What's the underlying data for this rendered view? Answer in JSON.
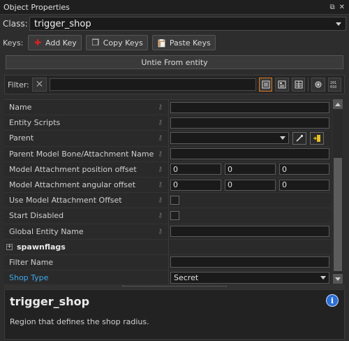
{
  "window": {
    "title": "Object Properties",
    "controls": [
      "⧉",
      "✕"
    ]
  },
  "class_row": {
    "label": "Class:",
    "value": "trigger_shop"
  },
  "keys_row": {
    "label": "Keys:",
    "add_key": "Add Key",
    "copy_keys": "Copy Keys",
    "paste_keys": "Paste Keys"
  },
  "untie_button": "Untie From entity",
  "filter": {
    "label": "Filter:",
    "value": ""
  },
  "properties": [
    {
      "name": "Name",
      "value": ""
    },
    {
      "name": "Entity Scripts",
      "value": ""
    },
    {
      "name": "Parent",
      "value": ""
    },
    {
      "name": "Parent Model Bone/Attachment Name",
      "value": ""
    },
    {
      "name": "Model Attachment position offset",
      "values": [
        "0",
        "0",
        "0"
      ]
    },
    {
      "name": "Model Attachment angular offset",
      "values": [
        "0",
        "0",
        "0"
      ]
    },
    {
      "name": "Use Model Attachment Offset",
      "checked": false
    },
    {
      "name": "Start Disabled",
      "checked": false
    },
    {
      "name": "Global Entity Name",
      "value": ""
    },
    {
      "name": "spawnflags"
    },
    {
      "name": "Filter Name",
      "value": ""
    },
    {
      "name": "Shop Type",
      "value": "Secret"
    }
  ],
  "help": {
    "title": "trigger_shop",
    "description": "Region that defines the shop radius."
  },
  "colors": {
    "accent_orange": "#e07818",
    "link_blue": "#3ea8e8",
    "info_blue": "#2a6fd8",
    "add_red": "#e02020"
  },
  "icons": [
    "add-key-icon",
    "copy-icon",
    "paste-icon",
    "clear-filter-icon",
    "view-list-icon",
    "view-text-icon",
    "view-keyvalue-icon",
    "pick-entity-icon",
    "binary-icon",
    "eyedropper-icon",
    "select-parent-icon",
    "info-icon",
    "key-icon"
  ]
}
